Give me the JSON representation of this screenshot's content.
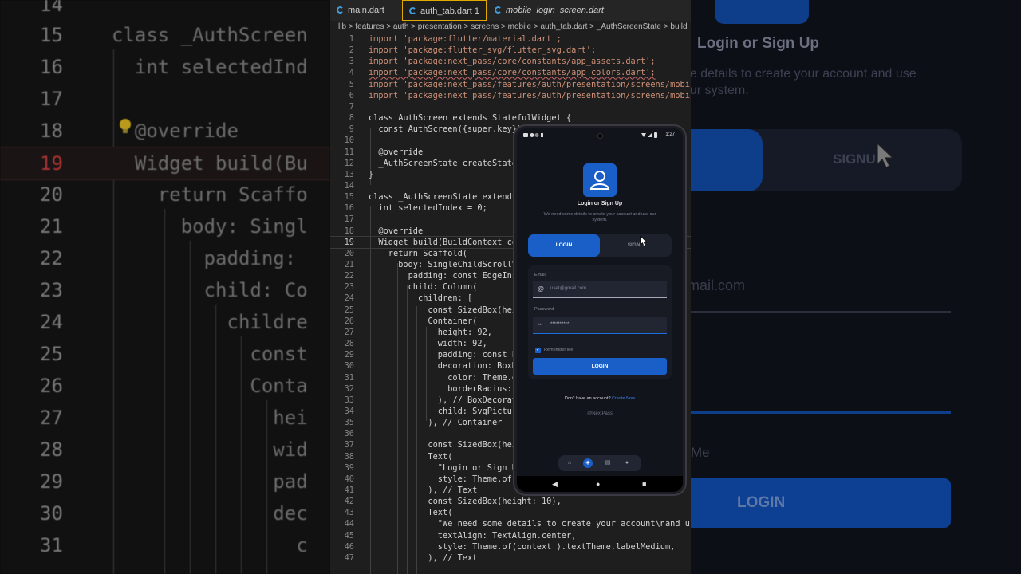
{
  "editor": {
    "tabs": [
      {
        "label": "main.dart"
      },
      {
        "label": "auth_tab.dart 1"
      },
      {
        "label": "mobile_login_screen.dart"
      }
    ],
    "breadcrumb": "lib > features > auth > presentation > screens > mobile > auth_tab.dart > _AuthScreenState > build",
    "lines": [
      {
        "n": "1",
        "t": "import 'package:flutter/material.dart';"
      },
      {
        "n": "2",
        "t": "import 'package:flutter_svg/flutter_svg.dart';"
      },
      {
        "n": "3",
        "t": "import 'package:next_pass/core/constants/app_assets.dart';"
      },
      {
        "n": "4",
        "t": "import 'package:next_pass/core/constants/app_colors.dart';"
      },
      {
        "n": "5",
        "t": "import 'package:next_pass/features/auth/presentation/screens/mobile/mo"
      },
      {
        "n": "6",
        "t": "import 'package:next_pass/features/auth/presentation/screens/mobile/mo"
      },
      {
        "n": "7",
        "t": ""
      },
      {
        "n": "8",
        "t": "class AuthScreen extends StatefulWidget {"
      },
      {
        "n": "9",
        "t": "  const AuthScreen({super.key});"
      },
      {
        "n": "10",
        "t": ""
      },
      {
        "n": "11",
        "t": "  @override"
      },
      {
        "n": "12",
        "t": "  _AuthScreenState createState("
      },
      {
        "n": "13",
        "t": "}"
      },
      {
        "n": "14",
        "t": ""
      },
      {
        "n": "15",
        "t": "class _AuthScreenState extends S"
      },
      {
        "n": "16",
        "t": "  int selectedIndex = 0;"
      },
      {
        "n": "17",
        "t": ""
      },
      {
        "n": "18",
        "t": "  @override"
      },
      {
        "n": "19",
        "t": "  Widget build(BuildContext con"
      },
      {
        "n": "20",
        "t": "    return Scaffold("
      },
      {
        "n": "21",
        "t": "      body: SingleChildScrollVie"
      },
      {
        "n": "22",
        "t": "        padding: const EdgeInset"
      },
      {
        "n": "23",
        "t": "        child: Column("
      },
      {
        "n": "24",
        "t": "          children: ["
      },
      {
        "n": "25",
        "t": "            const SizedBox(heig"
      },
      {
        "n": "26",
        "t": "            Container("
      },
      {
        "n": "27",
        "t": "              height: 92,"
      },
      {
        "n": "28",
        "t": "              width: 92,"
      },
      {
        "n": "29",
        "t": "              padding: const Edg"
      },
      {
        "n": "30",
        "t": "              decoration: BoxDec"
      },
      {
        "n": "31",
        "t": "                color: Theme.of"
      },
      {
        "n": "32",
        "t": "                borderRadius: Bo"
      },
      {
        "n": "33",
        "t": "              ), // BoxDecorati"
      },
      {
        "n": "34",
        "t": "              child: SvgPicture"
      },
      {
        "n": "35",
        "t": "            ), // Container"
      },
      {
        "n": "36",
        "t": ""
      },
      {
        "n": "37",
        "t": "            const SizedBox(heig"
      },
      {
        "n": "38",
        "t": "            Text("
      },
      {
        "n": "39",
        "t": "              \"Login or Sign Up"
      },
      {
        "n": "40",
        "t": "              style: Theme.of(co"
      },
      {
        "n": "41",
        "t": "            ), // Text"
      },
      {
        "n": "42",
        "t": "            const SizedBox(height: 10),"
      },
      {
        "n": "43",
        "t": "            Text("
      },
      {
        "n": "44",
        "t": "              \"We need some details to create your account\\nand use ou"
      },
      {
        "n": "45",
        "t": "              textAlign: TextAlign.center,"
      },
      {
        "n": "46",
        "t": "              style: Theme.of(context ).textTheme.labelMedium,"
      },
      {
        "n": "47",
        "t": "            ), // Text"
      }
    ]
  },
  "zoom_left": {
    "rows": [
      {
        "n": "14",
        "t": ""
      },
      {
        "n": "15",
        "t": "class _AuthScreen"
      },
      {
        "n": "16",
        "t": "  int selectedInd"
      },
      {
        "n": "17",
        "t": ""
      },
      {
        "n": "18",
        "t": "  @override"
      },
      {
        "n": "19",
        "t": "  Widget build(Bu"
      },
      {
        "n": "20",
        "t": "    return Scaffo"
      },
      {
        "n": "21",
        "t": "      body: Singl"
      },
      {
        "n": "22",
        "t": "        padding:"
      },
      {
        "n": "23",
        "t": "        child: Co"
      },
      {
        "n": "24",
        "t": "          childre"
      },
      {
        "n": "25",
        "t": "            const"
      },
      {
        "n": "26",
        "t": "            Conta"
      },
      {
        "n": "27",
        "t": "              hei"
      },
      {
        "n": "28",
        "t": "              wid"
      },
      {
        "n": "29",
        "t": "              pad"
      },
      {
        "n": "30",
        "t": "              dec"
      },
      {
        "n": "31",
        "t": "                c"
      }
    ]
  },
  "zoom_right": {
    "title": "Login or Sign Up",
    "subtitle": "he details to create your account and use our system.",
    "signup": "SIGNU",
    "email": "mail.com",
    "remember": "Me",
    "login": "LOGIN"
  },
  "phone": {
    "status_time": "1:27",
    "title": "Login or Sign Up",
    "subtitle": "We need some details to create your account and use our system.",
    "tab_login": "LOGIN",
    "tab_signup": "SIGNU",
    "email_label": "Email",
    "email_placeholder": "user@gmail.com",
    "password_label": "Password",
    "password_value": "**********",
    "remember_me": "Remember Me",
    "login_button": "LOGIN",
    "no_account": "Don't have an account?",
    "create_now": "Create Now",
    "brand": "@NextPass"
  },
  "colors": {
    "accent": "#1a5fc8",
    "editor_bg": "#1e1e1e",
    "phone_bg": "#12141c"
  }
}
